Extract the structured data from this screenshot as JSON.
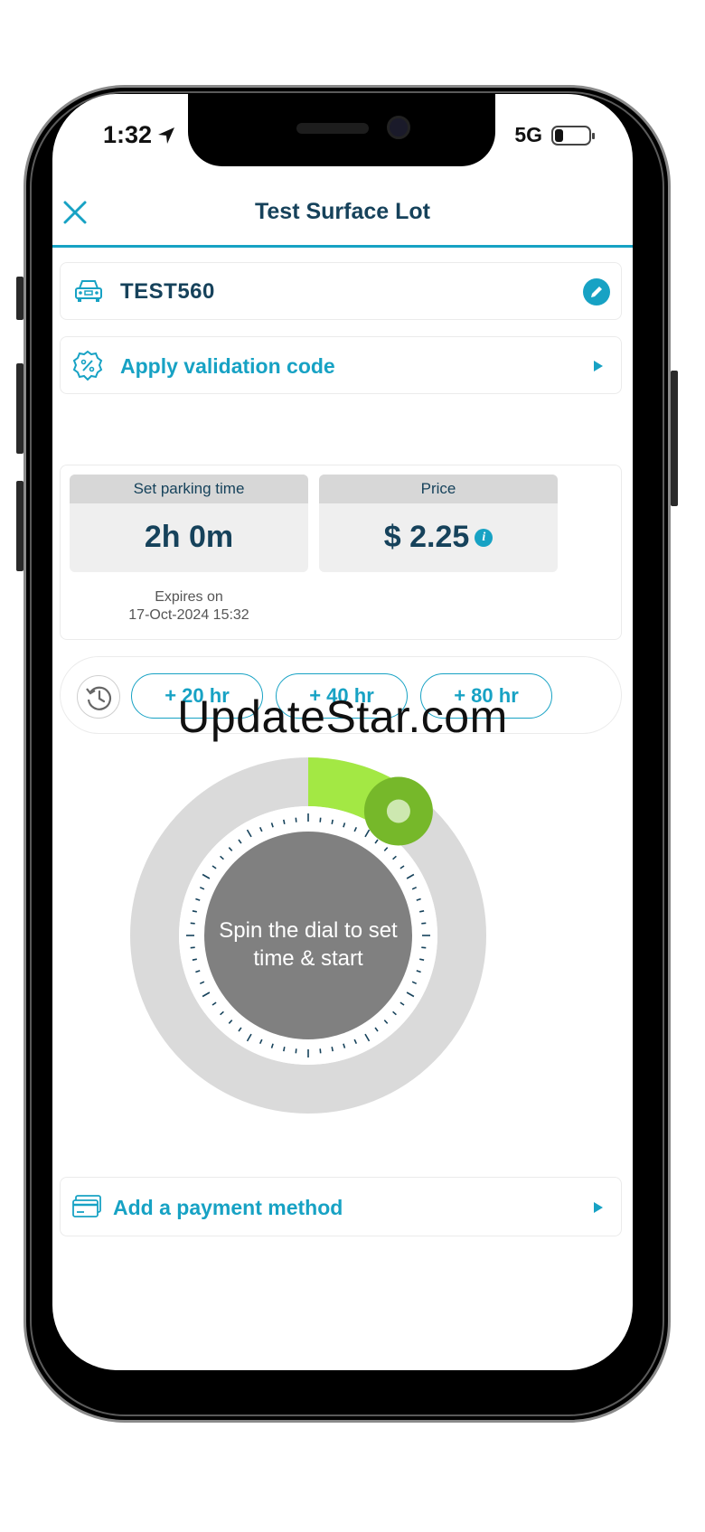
{
  "status_bar": {
    "time": "1:32",
    "network": "5G"
  },
  "header": {
    "title": "Test Surface Lot"
  },
  "vehicle": {
    "plate": "TEST560"
  },
  "validation": {
    "label": "Apply validation code"
  },
  "parking": {
    "time_label": "Set parking time",
    "time_value": "2h 0m",
    "price_label": "Price",
    "price_value": "$ 2.25",
    "info_glyph": "i",
    "expires_label": "Expires on",
    "expires_value": "17-Oct-2024 15:32"
  },
  "quick_add": [
    {
      "label": "+ 20 hr"
    },
    {
      "label": "+ 40 hr"
    },
    {
      "label": "+ 80 hr"
    }
  ],
  "watermark": "UpdateStar.com",
  "dial": {
    "prompt": "Spin the dial to set time & start",
    "fill_fraction": 0.1,
    "accent": "#a3e844",
    "knob": "#76b82a"
  },
  "payment": {
    "label": "Add a payment method"
  },
  "colors": {
    "primary": "#17a2c4",
    "text_dark": "#16425b"
  },
  "icons": [
    "close-icon",
    "car-icon",
    "edit-pencil-icon",
    "percent-badge-icon",
    "chevron-right-icon",
    "info-icon",
    "history-icon",
    "credit-card-icon",
    "location-arrow-icon",
    "battery-icon"
  ]
}
